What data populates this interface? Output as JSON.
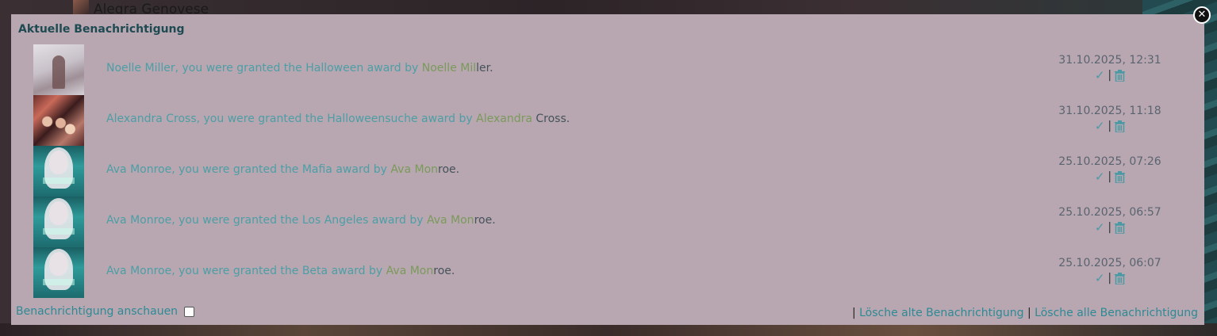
{
  "background": {
    "name_text": "Alegra Genovese"
  },
  "modal": {
    "title": "Aktuelle Benachrichtigung",
    "close_icon": "close-icon",
    "notifications": [
      {
        "recipient": "Noelle Miller",
        "text_mid": ", you were granted the Halloween award by ",
        "by_green": "Noelle Mil",
        "by_rest": "ler",
        "end": ".",
        "timestamp": "31.10.2025, 12:31"
      },
      {
        "recipient": "Alexandra Cross",
        "text_mid": ", you were granted the Halloweensuche award by ",
        "by_green": "Alexandra",
        "by_rest": " Cross",
        "end": ".",
        "timestamp": "31.10.2025, 11:18"
      },
      {
        "recipient": "Ava Monroe",
        "text_mid": ", you were granted the Mafia award by ",
        "by_green": "Ava Mon",
        "by_rest": "roe",
        "end": ".",
        "timestamp": "25.10.2025, 07:26"
      },
      {
        "recipient": "Ava Monroe",
        "text_mid": ", you were granted the Los Angeles award by ",
        "by_green": "Ava Mon",
        "by_rest": "roe",
        "end": ".",
        "timestamp": "25.10.2025, 06:57"
      },
      {
        "recipient": "Ava Monroe",
        "text_mid": ", you were granted the Beta award by ",
        "by_green": "Ava Mon",
        "by_rest": "roe",
        "end": ".",
        "timestamp": "25.10.2025, 06:07"
      }
    ],
    "action_separator": "|",
    "footer": {
      "view_label": "Benachrichtigung anschauen",
      "pipe": "|",
      "delete_old_label": "Lösche alte Benachrichtigung",
      "delete_all_label": "Lösche alle Benachrichtigung"
    }
  },
  "colors": {
    "modal_bg": "#b8a7b1",
    "link": "#4c9ea6",
    "author_green": "#7a9a5a",
    "title": "#1e4a52"
  }
}
